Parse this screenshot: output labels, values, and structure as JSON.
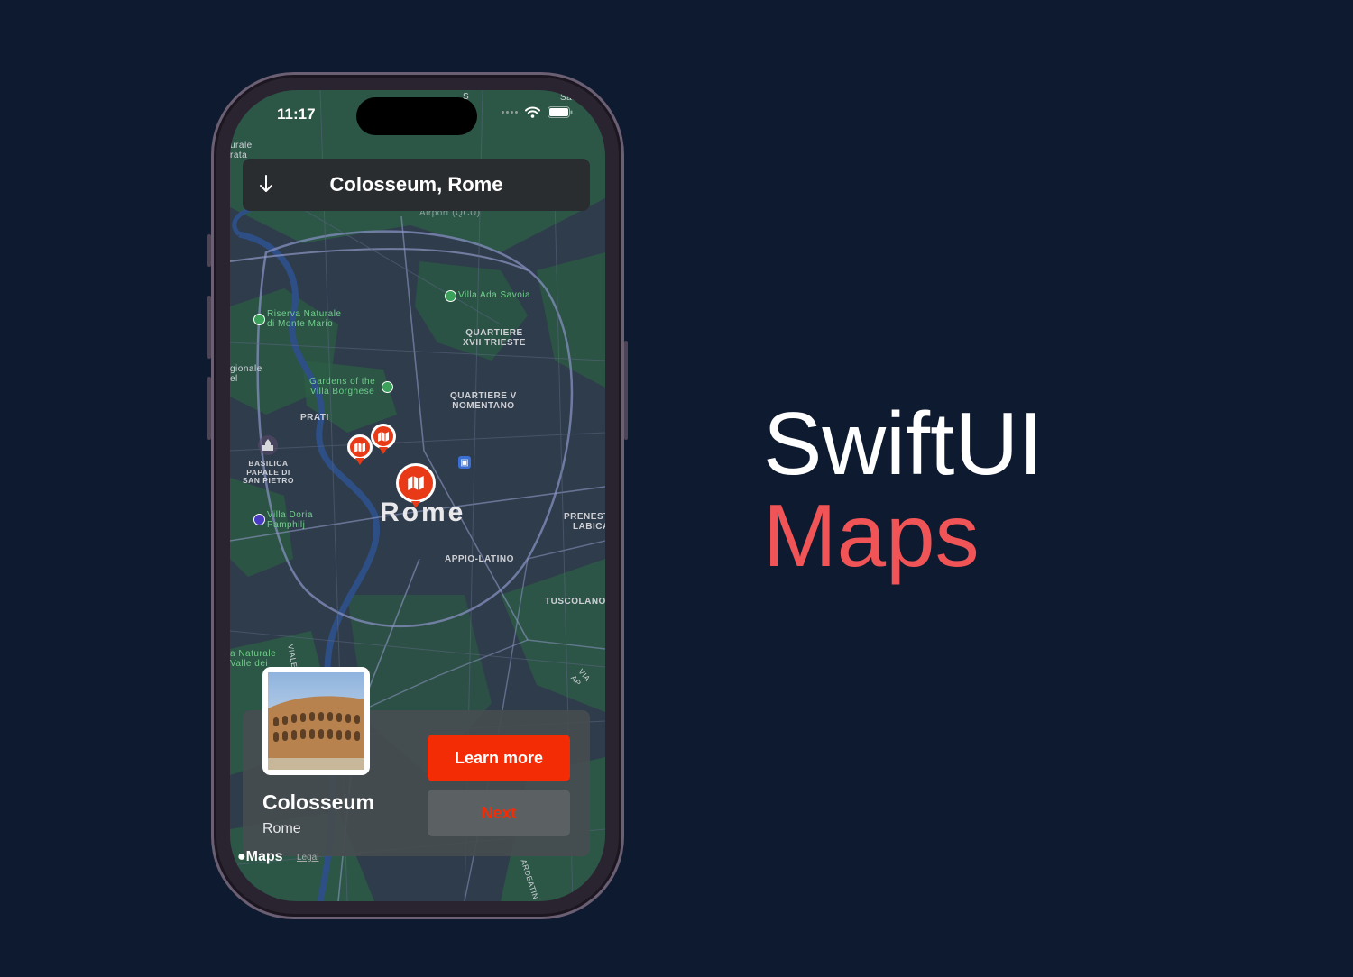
{
  "status_bar": {
    "time": "11:17"
  },
  "header": {
    "back_icon": "arrow-down-icon",
    "title": "Colosseum, Rome"
  },
  "map": {
    "city_label": "Rome",
    "districts": [
      "QUARTIERE\nXVII TRIESTE",
      "QUARTIERE V\nNOMENTANO",
      "PRATI",
      "APPIO-LATINO",
      "TUSCOLANO",
      "PRENEST\nLABICA"
    ],
    "parks": [
      "Villa Ada Savoia",
      "Riserva Naturale\ndi Monte Mario",
      "Gardens of the\nVilla Borghese",
      "Villa Doria\nPamphilj",
      "a Naturale\nValle dei"
    ],
    "other_labels": [
      "BASILICA\nPAPALE DI\nSAN PIETRO",
      "Airport (QCU)",
      "urale\nrata",
      "gionale\nel",
      "Sabi",
      "VIALE GUGLIE",
      "VIA AP",
      "ARDEATIN",
      "S"
    ],
    "pin_icon": "map-icon",
    "colors": {
      "pin": "#e83a16",
      "park": "#6fcf8a"
    }
  },
  "card": {
    "image_alt": "colosseum-photo",
    "name": "Colosseum",
    "city": "Rome",
    "learn_more_label": "Learn more",
    "next_label": "Next",
    "colors": {
      "primary": "#f42c06",
      "secondary_bg": "#5b6163"
    }
  },
  "attribution": {
    "brand": "Maps",
    "legal": "Legal"
  },
  "promo": {
    "line1": "SwiftUI",
    "line2": "Maps",
    "accent": "#f05456"
  }
}
